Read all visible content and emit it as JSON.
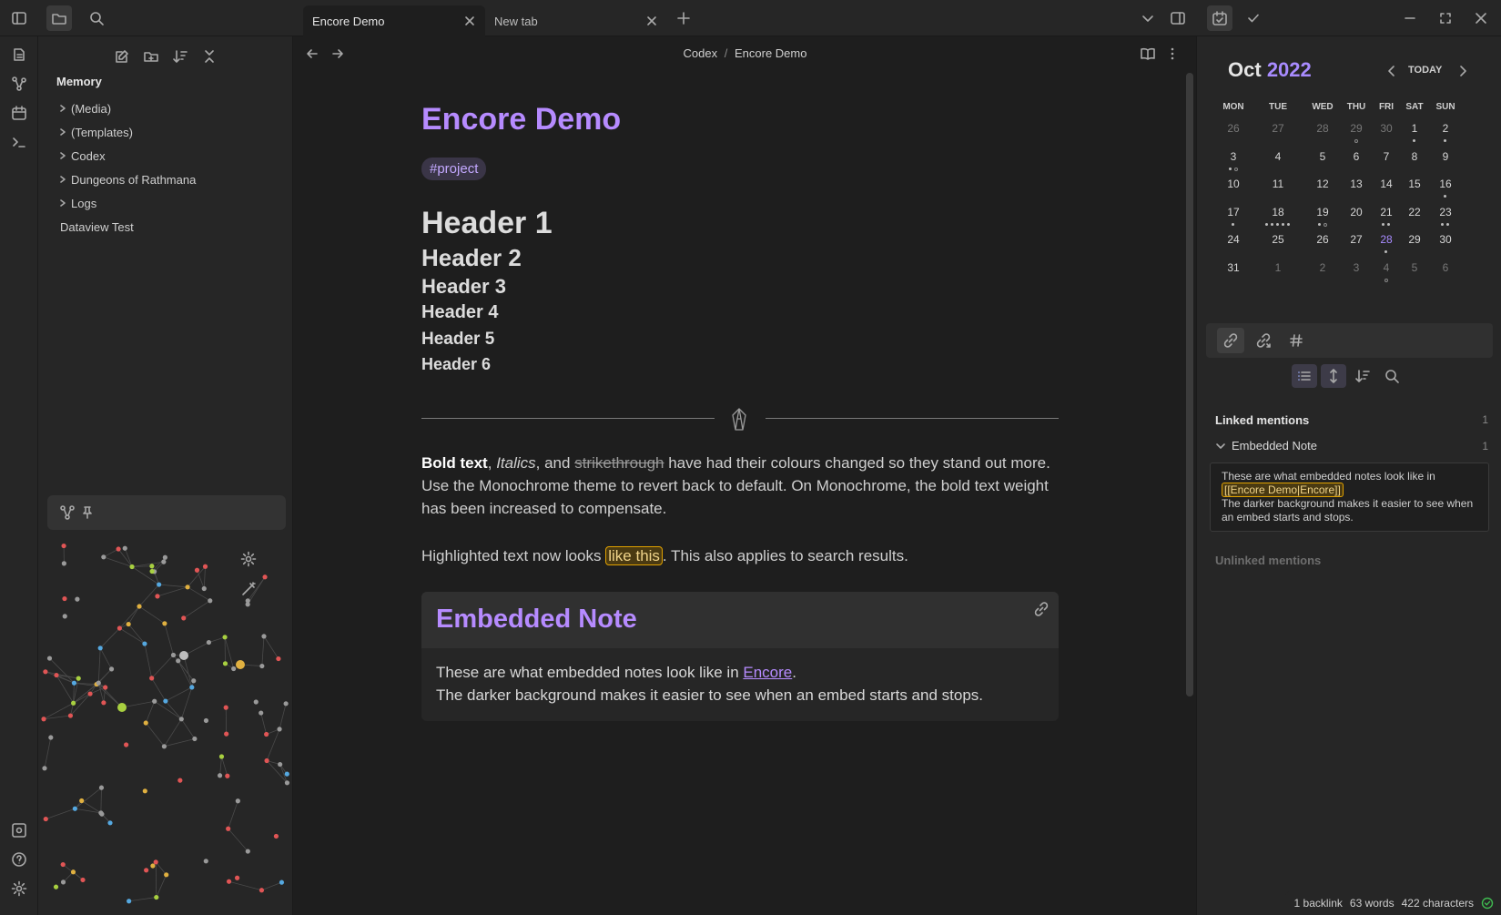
{
  "window": {
    "tabs": [
      {
        "label": "Encore Demo",
        "active": true
      },
      {
        "label": "New tab",
        "active": false
      }
    ]
  },
  "file_explorer": {
    "vault_name": "Memory",
    "items": [
      {
        "label": "(Media)",
        "type": "folder"
      },
      {
        "label": "(Templates)",
        "type": "folder"
      },
      {
        "label": "Codex",
        "type": "folder"
      },
      {
        "label": "Dungeons of Rathmana",
        "type": "folder"
      },
      {
        "label": "Logs",
        "type": "folder"
      },
      {
        "label": "Dataview Test",
        "type": "file"
      }
    ]
  },
  "breadcrumb": {
    "parent": "Codex",
    "separator": "/",
    "current": "Encore Demo"
  },
  "note": {
    "title": "Encore Demo",
    "tag": "#project",
    "headers": [
      "Header 1",
      "Header 2",
      "Header 3",
      "Header 4",
      "Header 5",
      "Header 6"
    ],
    "paragraph1": {
      "bold": "Bold text",
      "sep1": ", ",
      "italic": "Italics",
      "sep2": ", and ",
      "strike": "strikethrough",
      "rest": " have had their colours changed so they stand out more. Use the Monochrome theme to revert back to default. On Monochrome, the bold text weight has been increased to compensate."
    },
    "paragraph2": {
      "before": "Highlighted text now looks ",
      "highlight": "like this",
      "after": ". This also applies to search results."
    },
    "embed": {
      "title": "Embedded Note",
      "line1_before": "These are what embedded notes look like in ",
      "line1_link": "Encore",
      "line1_after": ".",
      "line2": "The darker background makes it easier to see when an embed starts and stops."
    }
  },
  "calendar": {
    "month": "Oct",
    "year": "2022",
    "today_label": "TODAY",
    "weekdays": [
      "MON",
      "TUE",
      "WED",
      "THU",
      "FRI",
      "SAT",
      "SUN"
    ],
    "weeks": [
      [
        "26",
        "27",
        "28",
        "29",
        "30",
        "1",
        "2"
      ],
      [
        "3",
        "4",
        "5",
        "6",
        "7",
        "8",
        "9"
      ],
      [
        "10",
        "11",
        "12",
        "13",
        "14",
        "15",
        "16"
      ],
      [
        "17",
        "18",
        "19",
        "20",
        "21",
        "22",
        "23"
      ],
      [
        "24",
        "25",
        "26",
        "27",
        "28",
        "29",
        "30"
      ],
      [
        "31",
        "1",
        "2",
        "3",
        "4",
        "5",
        "6"
      ]
    ]
  },
  "backlinks": {
    "linked_label": "Linked mentions",
    "linked_count": "1",
    "source_note": "Embedded Note",
    "source_count": "1",
    "snippet_before": "These are what embedded notes look like in ",
    "snippet_link": "[[Encore Demo|Encore]]",
    "snippet_after": "The darker background makes it easier to see when an embed starts and stops.",
    "unlinked_label": "Unlinked mentions"
  },
  "status": {
    "backlinks": "1 backlink",
    "words": "63 words",
    "characters": "422 characters"
  },
  "colors": {
    "accent": "#b68bff",
    "highlight_border": "#e0a100",
    "background": "#1e1e1e",
    "panel": "#262626"
  }
}
